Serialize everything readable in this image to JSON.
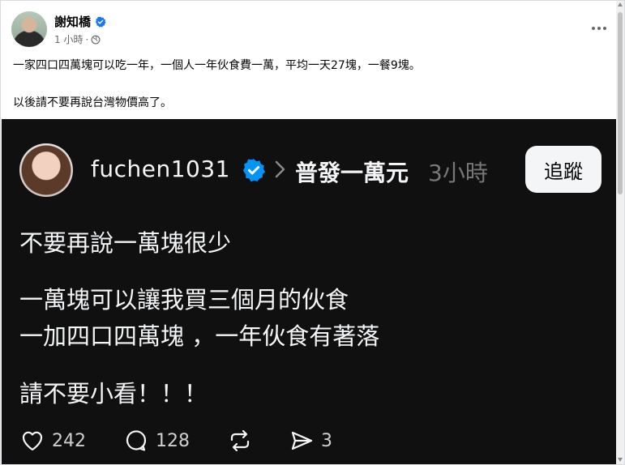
{
  "post": {
    "author": "謝知橋",
    "time": "1 小時",
    "separator": "·",
    "line1": "一家四口四萬塊可以吃一年，一個人一年伙食費一萬，平均一天27塊，一餐9塊。",
    "line2": "以後請不要再說台灣物價高了。"
  },
  "threads": {
    "username": "fuchen1031",
    "community": "普發一萬元",
    "time": "3小時",
    "follow_label": "追蹤",
    "lines": [
      "不要再說一萬塊很少",
      "一萬塊可以讓我買三個月的伙食",
      "一加四口四萬塊 ，一年伙食有著落",
      "請不要小看！！！"
    ],
    "stats": {
      "likes": "242",
      "replies": "128",
      "shares": "3"
    }
  },
  "colors": {
    "verified": "#1877f2",
    "threads_bg": "#101010",
    "meta_gray": "#65676b"
  },
  "icons": [
    "verified-badge-icon",
    "globe-icon",
    "more-options-icon",
    "chevron-right-icon",
    "heart-icon",
    "reply-icon",
    "repost-icon",
    "share-icon"
  ]
}
